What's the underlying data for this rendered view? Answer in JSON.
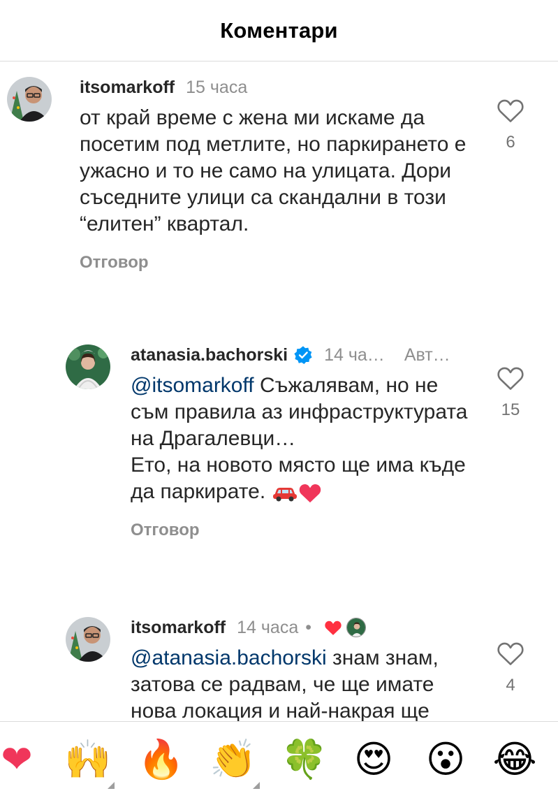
{
  "header": {
    "title": "Коментари"
  },
  "comments": [
    {
      "username": "itsomarkoff",
      "time": "15 часа",
      "text": "от край време с жена ми искаме да посетим под метлите, но паркирането е ужасно и то не само на улицата. Дори съседните улици са скандални в този “елитен” квартал.",
      "reply_label": "Отговор",
      "likes": "6"
    },
    {
      "username": "atanasia.bachorski",
      "verified": true,
      "time": "14 ча…",
      "author_badge": "Авт…",
      "mention": "@itsomarkoff",
      "text_lines": [
        " Съжалявам, но не съм правила аз инфраструктурата на Драгалевци…",
        "Ето, на новото място ще има къде да паркирате. "
      ],
      "emojis": [
        "car",
        "red-heart"
      ],
      "reply_label": "Отговор",
      "likes": "15"
    },
    {
      "username": "itsomarkoff",
      "time": "14 часа",
      "dot": "•",
      "liked_by_author": true,
      "mention": "@atanasia.bachorski",
      "text": " знам знам, затова се радвам, че ще имате нова локация и най-накрая ще",
      "likes": "4"
    }
  ],
  "emoji_bar": [
    {
      "name": "red-heart",
      "glyph": "❤"
    },
    {
      "name": "raising-hands",
      "glyph": "🙌"
    },
    {
      "name": "fire",
      "glyph": "🔥"
    },
    {
      "name": "clapping-hands",
      "glyph": "👏"
    },
    {
      "name": "four-leaf-clover",
      "glyph": "🍀"
    },
    {
      "name": "heart-eyes",
      "glyph": "😍"
    },
    {
      "name": "astonished-face",
      "glyph": "😮"
    },
    {
      "name": "tears-of-joy",
      "glyph": "😂"
    }
  ],
  "colors": {
    "mention": "#00376b",
    "secondary_text": "#8e8e8e",
    "verified": "#0095f6",
    "like_red": "#ff3040"
  }
}
